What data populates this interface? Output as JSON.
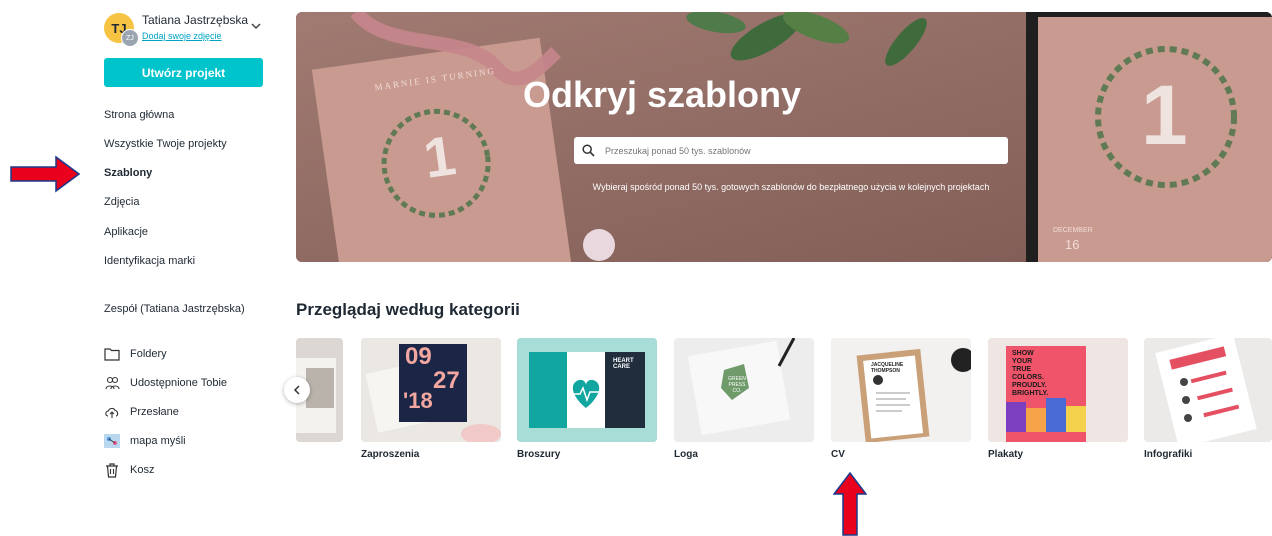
{
  "user": {
    "avatar_initials": "TJ",
    "avatar_sub": "ZJ",
    "name": "Tatiana Jastrzębska",
    "add_photo": "Dodaj swoje zdjęcie"
  },
  "sidebar": {
    "create_button": "Utwórz projekt",
    "nav": [
      {
        "label": "Strona główna",
        "active": false
      },
      {
        "label": "Wszystkie Twoje projekty",
        "active": false
      },
      {
        "label": "Szablony",
        "active": true
      },
      {
        "label": "Zdjęcia",
        "active": false
      },
      {
        "label": "Aplikacje",
        "active": false
      },
      {
        "label": "Identyfikacja marki",
        "active": false
      }
    ],
    "team": "Zespół (Tatiana Jastrzębska)",
    "tools": [
      {
        "label": "Foldery",
        "icon": "folder-icon"
      },
      {
        "label": "Udostępnione Tobie",
        "icon": "shared-users-icon"
      },
      {
        "label": "Przesłane",
        "icon": "upload-cloud-icon"
      },
      {
        "label": "mapa myśli",
        "icon": "mindmap-thumbnail-icon"
      },
      {
        "label": "Kosz",
        "icon": "trash-icon"
      }
    ]
  },
  "hero": {
    "title": "Odkryj szablony",
    "search_placeholder": "Przeszukaj ponad 50 tys. szablonów",
    "subtitle": "Wybieraj spośród ponad 50 tys. gotowych szablonów do bezpłatnego użycia w kolejnych projektach",
    "card_left_heading": "MARNIE IS TURNING",
    "card_number": "1",
    "card_right_month": "DECEMBER",
    "card_right_day": "16"
  },
  "categories": {
    "title": "Przeglądaj według kategorii",
    "items": [
      {
        "label": "",
        "thumb_color": "#d9d4cf"
      },
      {
        "label": "Zaproszenia",
        "thumb_color": "#e8e4e0"
      },
      {
        "label": "Broszury",
        "thumb_color": "#a8dcd6"
      },
      {
        "label": "Loga",
        "thumb_color": "#eeeeee"
      },
      {
        "label": "CV",
        "thumb_color": "#f2f1ef"
      },
      {
        "label": "Plakaty",
        "thumb_color": "#e9e2e0"
      },
      {
        "label": "Infografiki",
        "thumb_color": "#eceae8"
      }
    ],
    "invitation_date": [
      "09",
      "27",
      "'18"
    ],
    "brochure_text": "HEART CARE",
    "logo_text": "GREEN PRESS CO.",
    "cv_name": "JACQUELINE THOMPSON",
    "poster_text": [
      "SHOW",
      "YOUR",
      "TRUE",
      "COLORS.",
      "PROUDLY.",
      "BRIGHTLY."
    ]
  },
  "colors": {
    "accent": "#00c4cc",
    "link": "#00a3c4",
    "annotation_arrow": "#e8001c"
  }
}
